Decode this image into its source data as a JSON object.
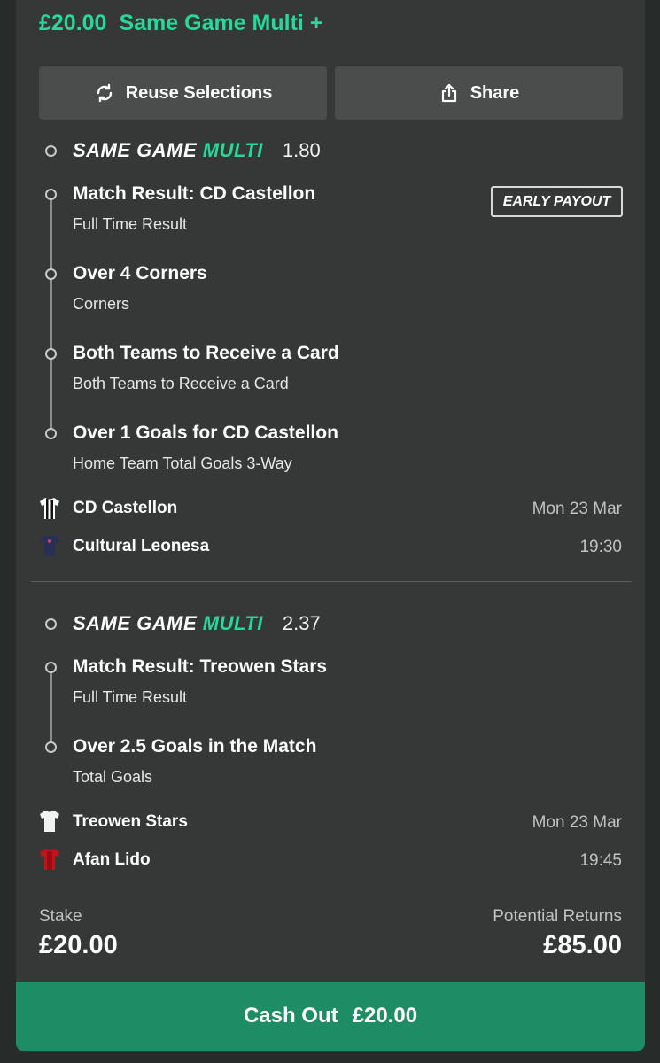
{
  "header": {
    "stake": "£20.00",
    "bet_type": "Same Game Multi +"
  },
  "actions": {
    "reuse_label": "Reuse Selections",
    "share_label": "Share"
  },
  "sgm_brand": {
    "same_game": "SAME GAME ",
    "multi": "MULTI"
  },
  "multis": [
    {
      "odds": "1.80",
      "badge": "EARLY PAYOUT",
      "legs": [
        {
          "title": "Match Result: CD Castellon",
          "sub": "Full Time Result"
        },
        {
          "title": "Over 4 Corners",
          "sub": "Corners"
        },
        {
          "title": "Both Teams to Receive a Card",
          "sub": "Both Teams to Receive a Card"
        },
        {
          "title": "Over 1 Goals for CD Castellon",
          "sub": "Home Team Total Goals 3-Way"
        }
      ],
      "home": {
        "name": "CD Castellon",
        "meta": "Mon 23 Mar"
      },
      "away": {
        "name": "Cultural Leonesa",
        "meta": "19:30"
      }
    },
    {
      "odds": "2.37",
      "legs": [
        {
          "title": "Match Result: Treowen Stars",
          "sub": "Full Time Result"
        },
        {
          "title": "Over 2.5 Goals in the Match",
          "sub": "Total Goals"
        }
      ],
      "home": {
        "name": "Treowen Stars",
        "meta": "Mon 23 Mar"
      },
      "away": {
        "name": "Afan Lido",
        "meta": "19:45"
      }
    }
  ],
  "footer": {
    "stake_label": "Stake",
    "stake_value": "£20.00",
    "returns_label": "Potential Returns",
    "returns_value": "£85.00"
  },
  "cashout": {
    "label": "Cash Out",
    "amount": "£20.00"
  },
  "colors": {
    "accent": "#28d79a",
    "cashout": "#1e8c64",
    "card": "#353837"
  }
}
